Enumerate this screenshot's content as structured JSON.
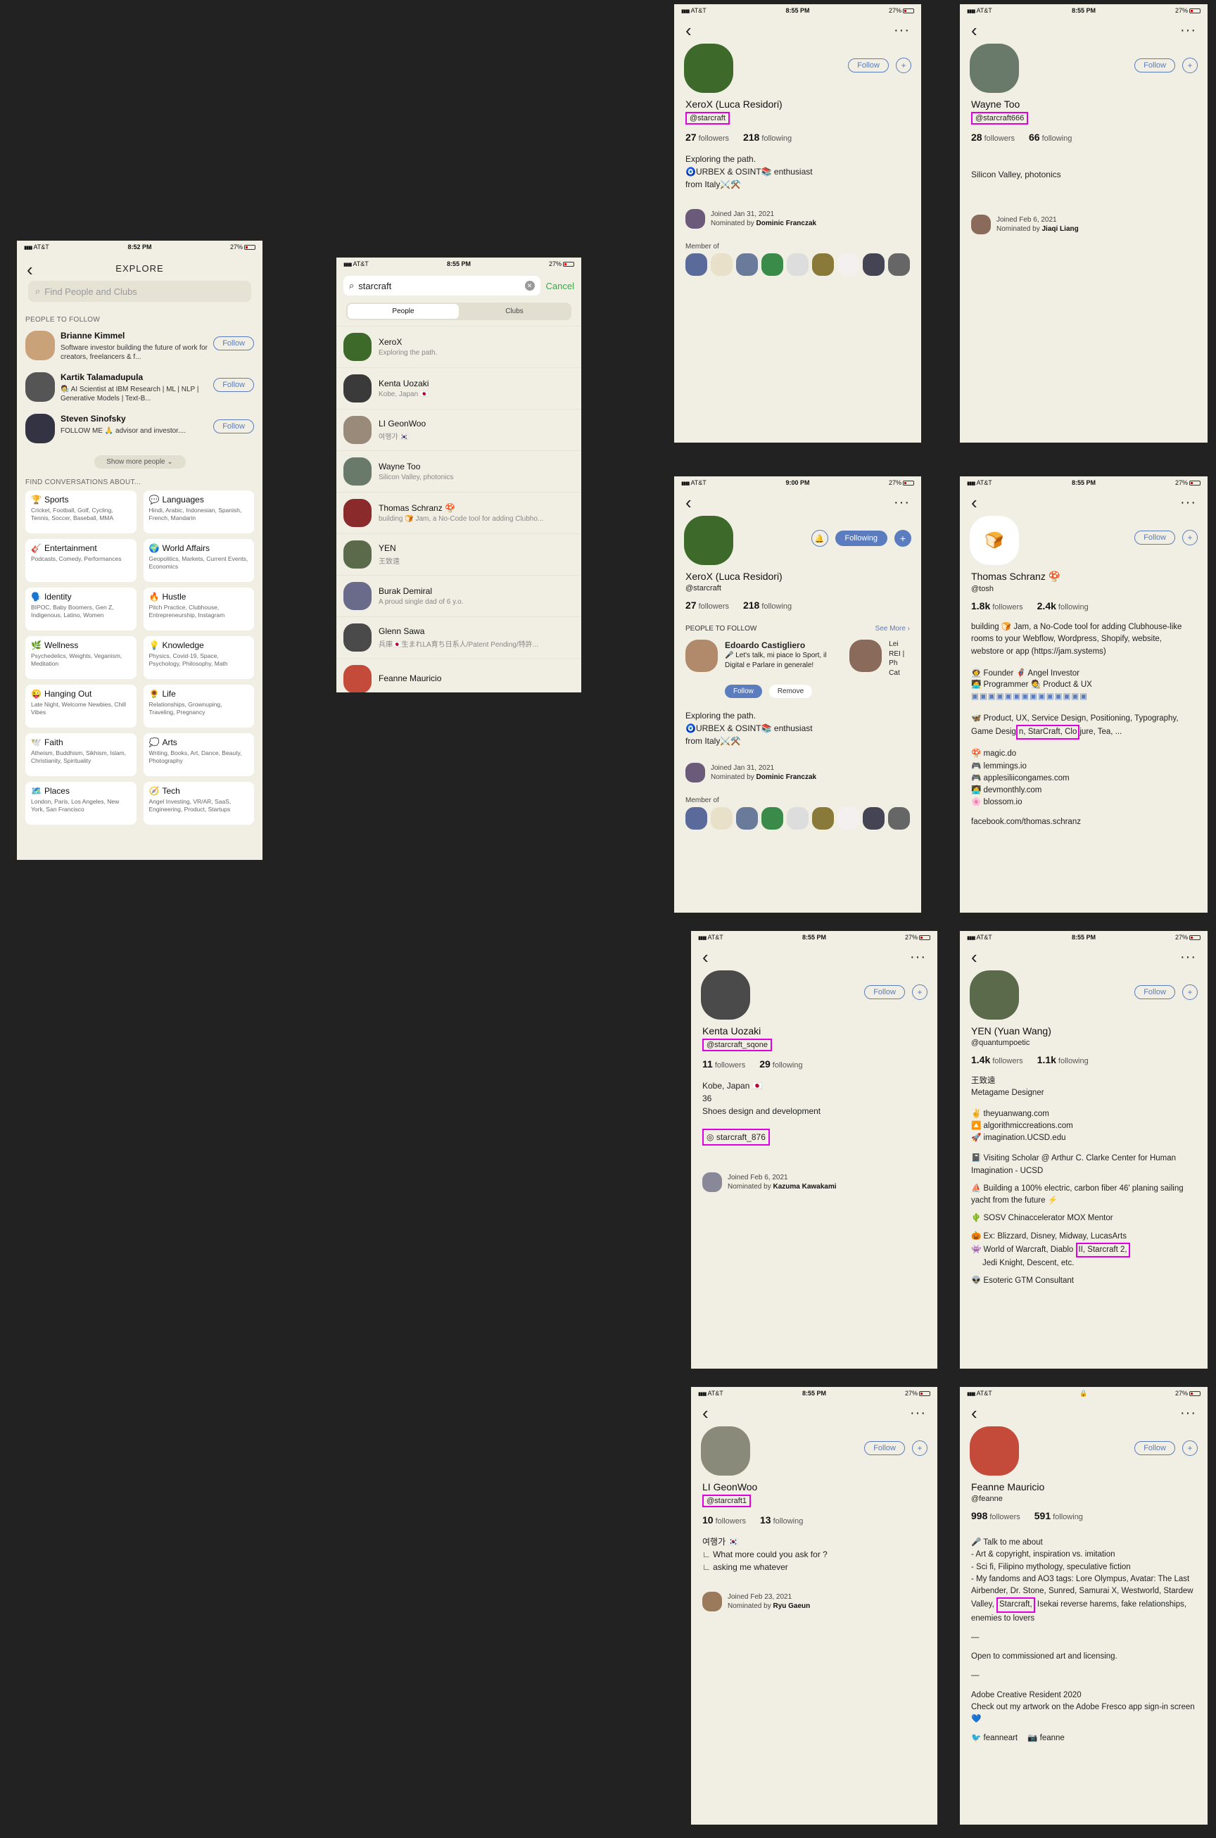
{
  "status": {
    "carrier": "AT&T",
    "battery": "27%"
  },
  "explore": {
    "time": "8:52 PM",
    "title": "EXPLORE",
    "search_placeholder": "Find People and Clubs",
    "people_header": "PEOPLE TO FOLLOW",
    "follow_label": "Follow",
    "people": [
      {
        "name": "Brianne Kimmel",
        "bio": "Software investor building the future of work for creators, freelancers & f..."
      },
      {
        "name": "Kartik Talamadupula",
        "bio": "🧑‍🔬 AI Scientist at IBM Research | ML | NLP | Generative Models | Text-B..."
      },
      {
        "name": "Steven Sinofsky",
        "bio": "FOLLOW ME 🙏 advisor and investor...."
      }
    ],
    "show_more": "Show more people ⌄",
    "conv_header": "FIND CONVERSATIONS ABOUT...",
    "topics": [
      {
        "icon": "🏆",
        "title": "Sports",
        "desc": "Cricket, Football, Golf, Cycling, Tennis, Soccer, Baseball, MMA"
      },
      {
        "icon": "💬",
        "title": "Languages",
        "desc": "Hindi, Arabic, Indonesian, Spanish, French, Mandarin"
      },
      {
        "icon": "🎸",
        "title": "Entertainment",
        "desc": "Podcasts, Comedy, Performances"
      },
      {
        "icon": "🌍",
        "title": "World Affairs",
        "desc": "Geopolitics, Markets, Current Events, Economics"
      },
      {
        "icon": "🗣️",
        "title": "Identity",
        "desc": "BIPOC, Baby Boomers, Gen Z, Indigenous, Latino, Women"
      },
      {
        "icon": "🔥",
        "title": "Hustle",
        "desc": "Pitch Practice, Clubhouse, Entrepreneurship, Instagram"
      },
      {
        "icon": "🌿",
        "title": "Wellness",
        "desc": "Psychedelics, Weights, Veganism, Meditation"
      },
      {
        "icon": "💡",
        "title": "Knowledge",
        "desc": "Physics, Covid-19, Space, Psychology, Philosophy, Math"
      },
      {
        "icon": "😜",
        "title": "Hanging Out",
        "desc": "Late Night, Welcome Newbies, Chill Vibes"
      },
      {
        "icon": "🌻",
        "title": "Life",
        "desc": "Relationships, Grownuping, Traveling, Pregnancy"
      },
      {
        "icon": "🕊️",
        "title": "Faith",
        "desc": "Atheism, Buddhism, Sikhism, Islam, Christianity, Spirituality"
      },
      {
        "icon": "💭",
        "title": "Arts",
        "desc": "Writing, Books, Art, Dance, Beauty, Photography"
      },
      {
        "icon": "🗺️",
        "title": "Places",
        "desc": "London, Paris, Los Angeles, New York, San Francisco"
      },
      {
        "icon": "🧭",
        "title": "Tech",
        "desc": "Angel Investing, VR/AR, SaaS, Engineering, Product, Startups"
      }
    ]
  },
  "search": {
    "time": "8:55 PM",
    "query": "starcraft",
    "cancel": "Cancel",
    "tab_people": "People",
    "tab_clubs": "Clubs",
    "results": [
      {
        "name": "XeroX",
        "sub": "Exploring the path."
      },
      {
        "name": "Kenta Uozaki",
        "sub": "Kobe, Japan 🇯🇵"
      },
      {
        "name": "LI GeonWoo",
        "sub": "여행가 🇰🇷"
      },
      {
        "name": "Wayne Too",
        "sub": "Silicon Valley, photonics"
      },
      {
        "name": "Thomas Schranz 🍄",
        "sub": "building 🍞 Jam, a No-Code tool for adding Clubho..."
      },
      {
        "name": "YEN",
        "sub": "王致遠"
      },
      {
        "name": "Burak Demiral",
        "sub": "A proud single dad of 6 y.o."
      },
      {
        "name": "Glenn Sawa",
        "sub": "兵庫🇯🇵生まれLA育ち日系人/Patent Pending/特許..."
      },
      {
        "name": "Feanne Mauricio",
        "sub": ""
      }
    ]
  },
  "xerox1": {
    "time": "8:55 PM",
    "name": "XeroX (Luca Residori)",
    "handle": "@starcraft",
    "followers": "27",
    "followers_label": "followers",
    "following": "218",
    "following_label": "following",
    "follow": "Follow",
    "bio1": "Exploring the path.",
    "bio2": "🧿URBEX & OSINT📚 enthusiast",
    "bio3": "from Italy⚔️⚒️",
    "joined": "Joined Jan 31, 2021",
    "nominated_prefix": "Nominated by",
    "nominated_by": "Dominic Franczak",
    "member_of": "Member of"
  },
  "wayne": {
    "time": "8:55 PM",
    "name": "Wayne Too",
    "handle": "@starcraft666",
    "followers": "28",
    "followers_label": "followers",
    "following": "66",
    "following_label": "following",
    "follow": "Follow",
    "bio": "Silicon Valley, photonics",
    "joined": "Joined Feb 6, 2021",
    "nominated_prefix": "Nominated by",
    "nominated_by": "Jiaqi Liang"
  },
  "xerox2": {
    "time": "9:00 PM",
    "name": "XeroX (Luca Residori)",
    "handle": "@starcraft",
    "followers": "27",
    "followers_label": "followers",
    "following": "218",
    "following_label": "following",
    "following_btn": "Following",
    "ptf": "PEOPLE TO FOLLOW",
    "see_more": "See More ›",
    "suggest_name": "Edoardo Castiglieго",
    "suggest_bio": "🎤 Let's talk, mi piace lo Sport, il Digital e Parlare in generale!",
    "suggest2": "Lei REI | Ph Cat",
    "follow": "Follow",
    "remove": "Remove",
    "bio1": "Exploring the path.",
    "bio2": "🧿URBEX & OSINT📚 enthusiast",
    "bio3": "from Italy⚔️⚒️",
    "joined": "Joined Jan 31, 2021",
    "nominated_prefix": "Nominated by",
    "nominated_by": "Dominic Franczak",
    "member_of": "Member of"
  },
  "thomas": {
    "time": "8:55 PM",
    "name": "Thomas Schranz 🍄",
    "handle": "@tosh",
    "followers": "1.8k",
    "followers_label": "followers",
    "following": "2.4k",
    "following_label": "following",
    "follow": "Follow",
    "bio": "building 🍞 Jam, a No-Code tool for adding Clubhouse-like rooms to your Webflow, Wordpress, Shopify, website, webstore or app (https://jam.systems)",
    "roles1": "👩‍🚀 Founder          🦸 Angel Investor",
    "roles2": "🧑‍💻 Programmer      🧑‍🎨 Product & UX",
    "interests_a": "🦋 Product, UX, Service Design, Positioning, Typography, Game Desig",
    "interests_hl": "n, StarCraft, Clo",
    "interests_b": "jure, Tea, ...",
    "link1": "🍄 magic.do",
    "link2": "🎮 lemmings.io",
    "link3": "🎮 applesiliicongames.com",
    "link4": "🧑‍💻 devmonthly.com",
    "link5": "🌸 blossom.io",
    "link6": "facebook.com/thomas.schranz"
  },
  "kenta": {
    "time": "8:55 PM",
    "name": "Kenta Uozaki",
    "handle": "@starcraft_sqone",
    "followers": "11",
    "followers_label": "followers",
    "following": "29",
    "following_label": "following",
    "follow": "Follow",
    "bio1": "Kobe, Japan 🇯🇵",
    "bio2": "36",
    "bio3": "Shoes design and development",
    "instagram": "starcraft_876",
    "joined": "Joined Feb 6, 2021",
    "nominated_prefix": "Nominated by",
    "nominated_by": "Kazuma Kawakami"
  },
  "yen": {
    "time": "8:55 PM",
    "name": "YEN (Yuan Wang)",
    "handle": "@quantumpoetic",
    "followers": "1.4k",
    "followers_label": "followers",
    "following": "1.1k",
    "following_label": "following",
    "follow": "Follow",
    "bio1": "王致遠",
    "bio2": "Metagame Designer",
    "link1": "✌️ theyuanwang.com",
    "link2": "🔼 algorithmiccreations.com",
    "link3": "🚀 imagination.UCSD.edu",
    "line1": "📓 Visiting Scholar @ Arthur C. Clarke Center for Human Imagination - UCSD",
    "line2": "⛵ Building a 100% electric, carbon fiber 46' planing sailing yacht from the future ⚡",
    "line3": "🌵 SOSV Chinaccelerator MOX Mentor",
    "line4": "🎃 Ex: Blizzard, Disney, Midway, LucasArts",
    "line5a": "👾 World of Warcraft, Diablo ",
    "line5hl": "II, Starcraft 2,",
    "line5b": "Jedi Knight, Descent, etc.",
    "line6": "👽 Esoteric GTM Consultant"
  },
  "li": {
    "time": "8:55 PM",
    "name": "LI GeonWoo",
    "handle": "@starcraft1",
    "followers": "10",
    "followers_label": "followers",
    "following": "13",
    "following_label": "following",
    "follow": "Follow",
    "bio1": "여행가 🇰🇷",
    "bio2": "∟ What more could you ask for ?",
    "bio3": "∟ asking me whatever",
    "joined": "Joined Feb 23, 2021",
    "nominated_prefix": "Nominated by",
    "nominated_by": "Ryu Gaeun"
  },
  "feanne": {
    "time": "",
    "name": "Feanne Mauricio",
    "handle": "@feanne",
    "followers": "998",
    "followers_label": "followers",
    "following": "591",
    "following_label": "following",
    "follow": "Follow",
    "bio1": "🎤 Talk to me about",
    "bio2": "- Art & copyright, inspiration vs. imitation",
    "bio3": "- Sci fi, Filipino mythology, speculative fiction",
    "bio4": "- My fandoms and AO3 tags: Lore Olympus, Avatar: The Last Airbender, Dr. Stone, Sunred, Samurai X, Westworld, Stardew Valley,",
    "bio4hl": "Starcraft,",
    "bio4b": "Isekai reverse harems, fake relationships, enemies to lovers",
    "sep1": "—",
    "bio5": "Open to commissioned art and licensing.",
    "sep2": "—",
    "bio6": "Adobe Creative Resident 2020",
    "bio7": "Check out my artwork on the Adobe Fresco app sign-in screen 💙",
    "tw": "🐦 feanneart",
    "ig": "📷 feanne"
  }
}
